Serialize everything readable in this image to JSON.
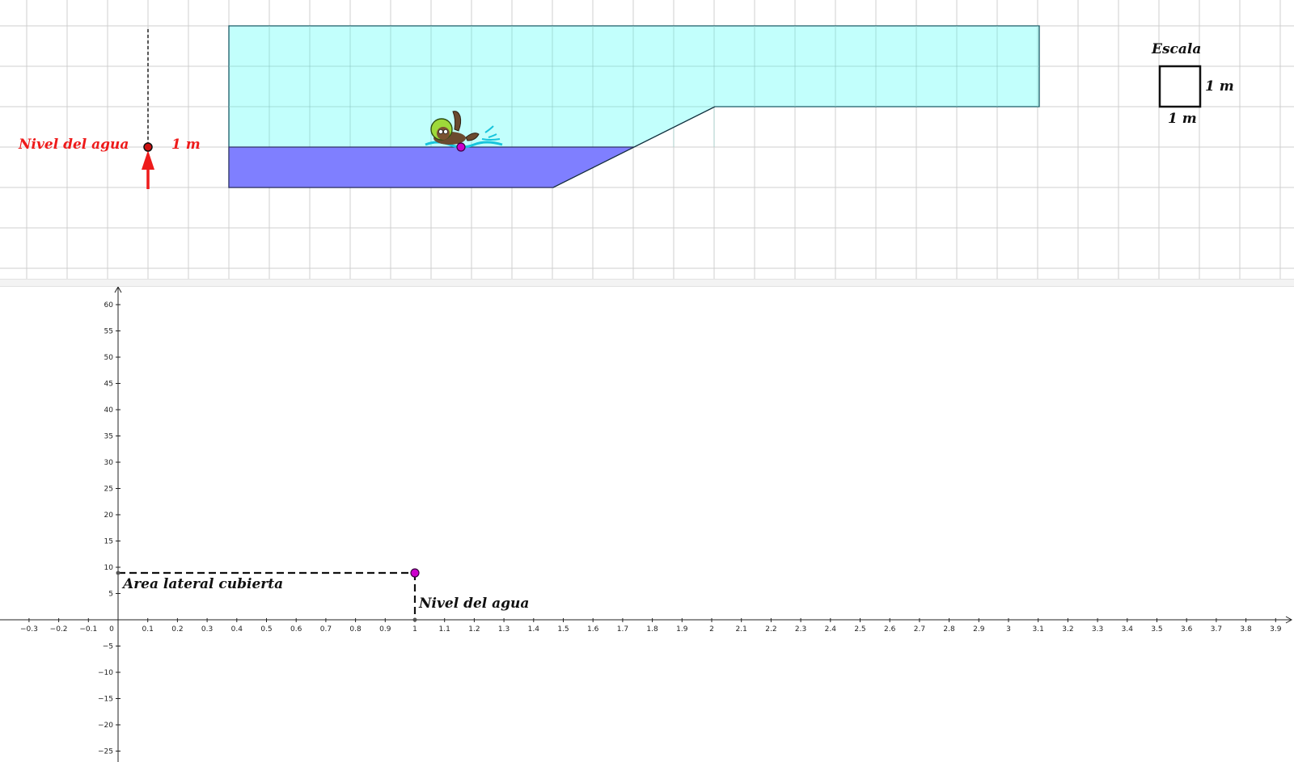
{
  "top_view": {
    "water_level_label": "Nivel del agua",
    "water_level_value": "1 m",
    "scale": {
      "title": "Escala",
      "side_label": "1 m",
      "bottom_label": "1 m"
    },
    "colors": {
      "pool": "#b7fffc",
      "water": "#7f7fff",
      "marker": "#ee1b1b",
      "swimmer_point": "#cc00cc"
    },
    "icons": [
      "swimmer-icon",
      "red-arrow-up-icon"
    ]
  },
  "graph": {
    "y_axis_label_point": "Area lateral cubierta",
    "x_axis_label_point": "Nivel del agua",
    "point": {
      "x": 1,
      "y": 9
    },
    "point_color": "#cc00cc",
    "x_ticks": [
      "−0.3",
      "−0.2",
      "−0.1",
      "0",
      "0.1",
      "0.2",
      "0.3",
      "0.4",
      "0.5",
      "0.6",
      "0.7",
      "0.8",
      "0.9",
      "1",
      "1.1",
      "1.2",
      "1.3",
      "1.4",
      "1.5",
      "1.6",
      "1.7",
      "1.8",
      "1.9",
      "2",
      "2.1",
      "2.2",
      "2.3",
      "2.4",
      "2.5",
      "2.6",
      "2.7",
      "2.8",
      "2.9",
      "3",
      "3.1",
      "3.2",
      "3.3",
      "3.4",
      "3.5",
      "3.6",
      "3.7",
      "3.8",
      "3.9"
    ],
    "y_ticks": [
      "60",
      "55",
      "50",
      "45",
      "40",
      "35",
      "30",
      "25",
      "20",
      "15",
      "10",
      "5",
      "−5",
      "−10",
      "−15",
      "−20",
      "−25"
    ]
  }
}
